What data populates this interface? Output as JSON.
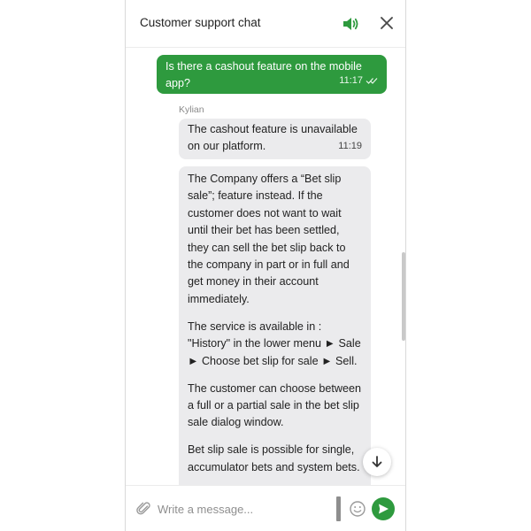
{
  "header": {
    "title": "Customer support chat",
    "sound_icon": "speaker-volume-icon",
    "close_icon": "close-icon"
  },
  "messages": {
    "outgoing": {
      "text": "Is there a cashout feature on the mobile app?",
      "time": "11:17",
      "status_icon": "double-check-icon"
    },
    "sender_name": "Kylian",
    "incoming_1": {
      "text": "The cashout feature is unavailable on our platform.",
      "time": "11:19"
    },
    "incoming_2": {
      "paragraphs": [
        "The Company offers a “Bet slip sale”; feature instead. If the customer does not want to wait until their bet has been settled, they can sell the bet slip back to the company in part or in full and get money in their account immediately.",
        "The service is available in : \"History\" in the lower menu ► Sale ► Choose bet slip for sale ► Sell.",
        "The customer can choose between a full or a partial sale in the bet slip sale dialog window.",
        "Bet slip sale is possible for single, accumulator bets and system bets."
      ]
    }
  },
  "composer": {
    "placeholder": "Write a message...",
    "attach_icon": "paperclip-icon",
    "emoji_icon": "smiley-icon",
    "send_icon": "send-arrow-icon"
  },
  "scroll_down_icon": "arrow-down-icon",
  "colors": {
    "accent": "#2e9a3e",
    "incoming_bubble": "#ebebed"
  }
}
